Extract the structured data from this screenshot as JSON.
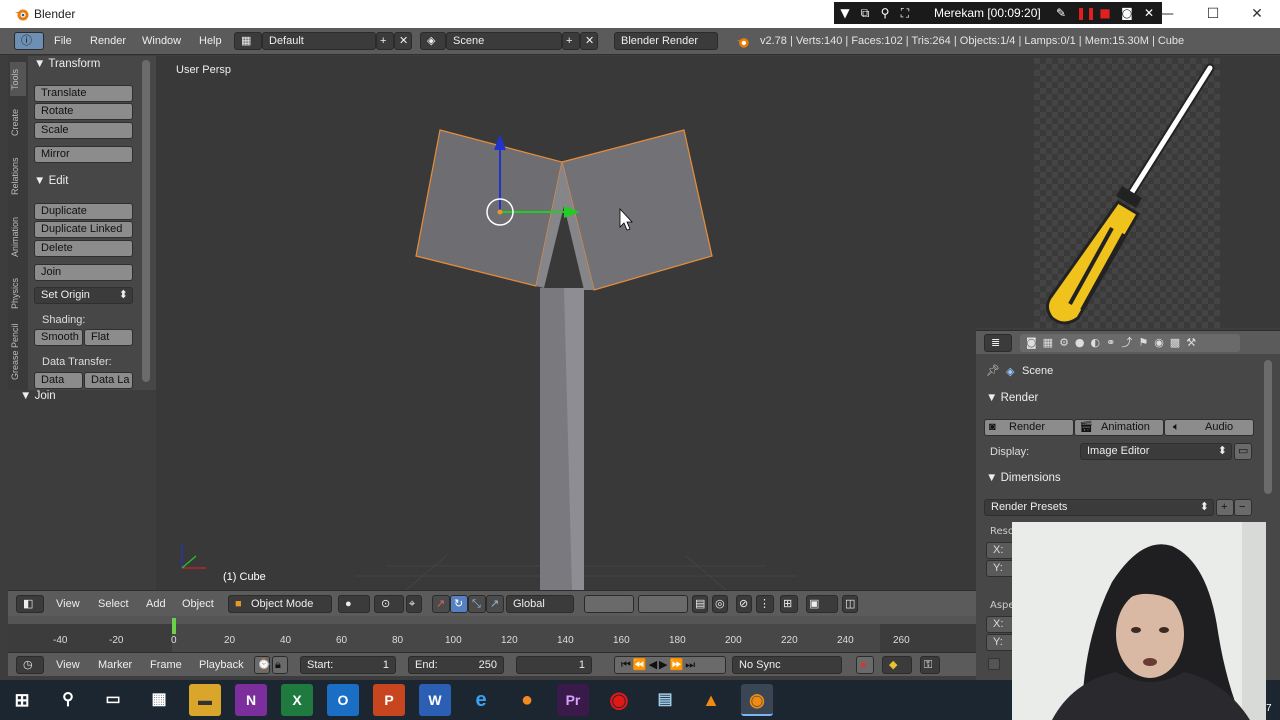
{
  "window": {
    "title": "Blender",
    "minimize": "—",
    "maximize": "☐",
    "close": "✕"
  },
  "recorder": {
    "label": "Merekam [00:09:20]"
  },
  "infobar": {
    "menus": [
      "File",
      "Render",
      "Window",
      "Help"
    ],
    "layout": "Default",
    "scene": "Scene",
    "engine": "Blender Render",
    "stats": "v2.78 | Verts:140 | Faces:102 | Tris:264 | Objects:1/4 | Lamps:0/1 | Mem:15.30M | Cube"
  },
  "tooltabs": [
    "Tools",
    "Create",
    "Relations",
    "Animation",
    "Physics",
    "Grease Pencil"
  ],
  "toolshelf": {
    "transform_title": "Transform",
    "transform_buttons": [
      "Translate",
      "Rotate",
      "Scale"
    ],
    "mirror": "Mirror",
    "edit_title": "Edit",
    "edit_buttons": [
      "Duplicate",
      "Duplicate Linked",
      "Delete"
    ],
    "join": "Join",
    "set_origin": "Set Origin",
    "shading_label": "Shading:",
    "smooth": "Smooth",
    "flat": "Flat",
    "data_transfer_label": "Data Transfer:",
    "data": "Data",
    "data_la": "Data La",
    "join_panel_title": "Join"
  },
  "viewport": {
    "view_label": "User Persp",
    "object_label": "(1) Cube"
  },
  "v3dheader": {
    "menus": [
      "View",
      "Select",
      "Add",
      "Object"
    ],
    "mode": "Object Mode",
    "orientation": "Global"
  },
  "timeline": {
    "ticks": [
      "-40",
      "-20",
      "0",
      "20",
      "40",
      "60",
      "80",
      "100",
      "120",
      "140",
      "160",
      "180",
      "200",
      "220",
      "240",
      "260"
    ],
    "menus": [
      "View",
      "Marker",
      "Frame",
      "Playback"
    ],
    "start_label": "Start:",
    "start_value": "1",
    "end_label": "End:",
    "end_value": "250",
    "current_frame": "1",
    "sync": "No Sync"
  },
  "properties": {
    "scene": "Scene",
    "render_title": "Render",
    "render_btn": "Render",
    "animation_btn": "Animation",
    "audio_btn": "Audio",
    "display_label": "Display:",
    "display_value": "Image Editor",
    "dimensions_title": "Dimensions",
    "presets": "Render Presets",
    "reso_label": "Reso",
    "aspect_label": "Aspe",
    "x_label": "X:",
    "y_label": "Y:"
  },
  "taskbar": {
    "clock": "7"
  }
}
